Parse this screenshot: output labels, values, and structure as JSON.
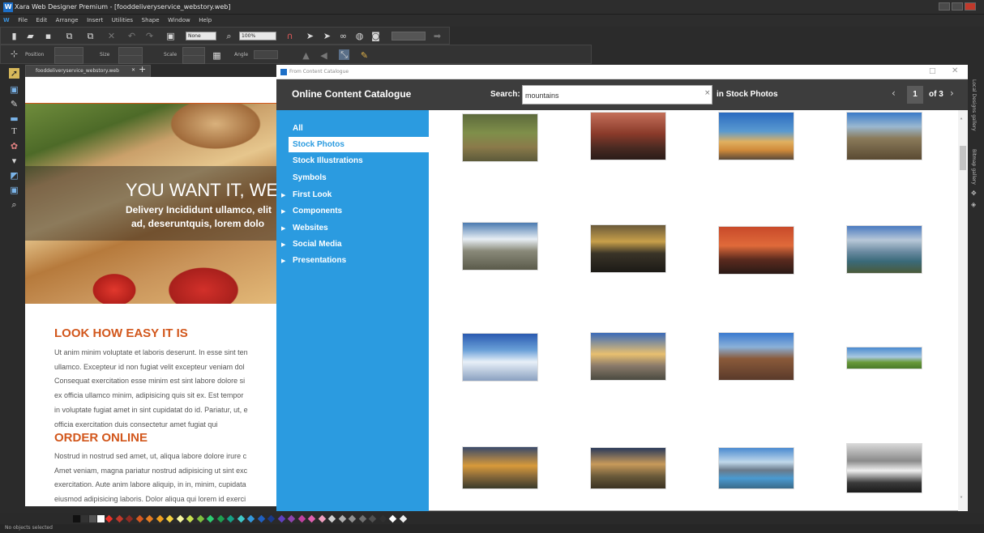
{
  "window": {
    "title": "Xara Web Designer Premium - [fooddeliveryservice_webstory.web]",
    "app_icon": "W"
  },
  "menu": [
    "File",
    "Edit",
    "Arrange",
    "Insert",
    "Utilities",
    "Shape",
    "Window",
    "Help"
  ],
  "toolbar": {
    "quality_value": "None",
    "zoom_value": "100%",
    "position_label": "Position",
    "size_label": "Size",
    "scale_label": "Scale",
    "angle_label": "Angle"
  },
  "document_tab": {
    "label": "fooddeliveryservice_webstory.web",
    "close": "✕",
    "add": "+"
  },
  "page": {
    "hero_title": "YOU WANT IT, WE",
    "hero_sub1": "Delivery Incididunt ullamco, elit",
    "hero_sub2": "ad, deseruntquis, lorem dolo",
    "section1_title": "LOOK HOW EASY IT IS",
    "section1_lines": [
      "Ut anim minim voluptate et laboris deserunt. In esse sint ten",
      "ullamco. Excepteur id non fugiat velit excepteur veniam dol",
      "Consequat exercitation esse minim est sint labore dolore si",
      "ex officia ullamco minim, adipisicing quis sit ex. Est tempor",
      "in voluptate fugiat amet in sint cupidatat do id. Pariatur, ut, e",
      "officia exercitation duis consectetur amet fugiat qui"
    ],
    "section2_title": "ORDER ONLINE",
    "section2_lines": [
      "Nostrud in nostrud sed amet, ut, aliqua labore dolore irure c",
      "Amet veniam, magna pariatur nostrud adipisicing ut sint exc",
      "exercitation. Aute anim labore aliquip, in in, minim, cupidata",
      "eiusmod adipisicing laboris. Dolor aliqua qui lorem id exerci"
    ]
  },
  "dialog": {
    "title": "From Content Catalogue",
    "catalogue_title": "Online Content Catalogue",
    "search_label": "Search:",
    "search_value": "mountains",
    "clear": "×",
    "in_label": "in Stock Photos",
    "pager": {
      "prev": "‹",
      "current": "1",
      "of": "of 3",
      "next": "›"
    },
    "nav": [
      {
        "label": "All",
        "expandable": false
      },
      {
        "label": "Stock Photos",
        "expandable": false,
        "selected": true
      },
      {
        "label": "Stock Illustrations",
        "expandable": false
      },
      {
        "label": "Symbols",
        "expandable": false
      },
      {
        "label": "First Look",
        "expandable": true
      },
      {
        "label": "Components",
        "expandable": true
      },
      {
        "label": "Websites",
        "expandable": true
      },
      {
        "label": "Social Media",
        "expandable": true
      },
      {
        "label": "Presentations",
        "expandable": true
      }
    ]
  },
  "right_tabs": [
    "Local Designs gallery",
    "Bitmap gallery"
  ],
  "statusbar": {
    "text": "No objects selected"
  },
  "colors": {
    "accent_nav": "#2b9be0",
    "heading_orange": "#d2571c",
    "header_dark": "#3d3d3d"
  }
}
